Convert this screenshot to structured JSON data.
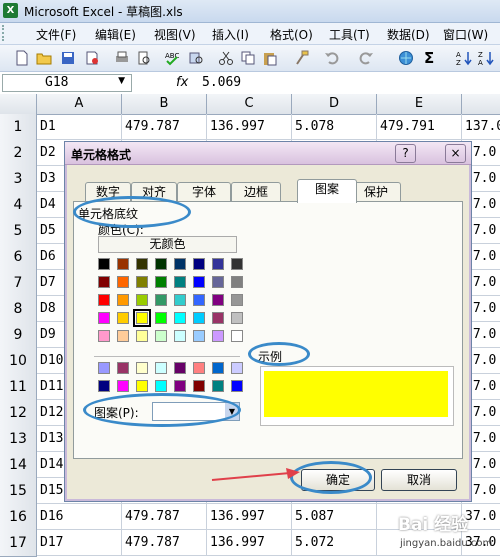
{
  "app": {
    "icon_letter": "X",
    "title": "Microsoft Excel - 草稿图.xls",
    "menus": [
      "文件(F)",
      "编辑(E)",
      "视图(V)",
      "插入(I)",
      "格式(O)",
      "工具(T)",
      "数据(D)",
      "窗口(W)"
    ],
    "name_box": "G18",
    "fx": "fx",
    "formula_value": "5.069"
  },
  "grid": {
    "columns": [
      "A",
      "B",
      "C",
      "D",
      "E",
      ""
    ],
    "rows": [
      {
        "num": "1",
        "cells": [
          "D1",
          "479.787",
          "136.997",
          "5.078",
          "479.791",
          "137.0"
        ]
      },
      {
        "num": "2",
        "cells": [
          "D2",
          "",
          "",
          "",
          "",
          "37.0"
        ]
      },
      {
        "num": "3",
        "cells": [
          "D3",
          "",
          "",
          "",
          "",
          "37.0"
        ]
      },
      {
        "num": "4",
        "cells": [
          "D4",
          "",
          "",
          "",
          "",
          "37.0"
        ]
      },
      {
        "num": "5",
        "cells": [
          "D5",
          "",
          "",
          "",
          "",
          "37.0"
        ]
      },
      {
        "num": "6",
        "cells": [
          "D6",
          "",
          "",
          "",
          "",
          "37.0"
        ]
      },
      {
        "num": "7",
        "cells": [
          "D7",
          "",
          "",
          "",
          "",
          "37.0"
        ]
      },
      {
        "num": "8",
        "cells": [
          "D8",
          "",
          "",
          "",
          "",
          "37.0"
        ]
      },
      {
        "num": "9",
        "cells": [
          "D9",
          "",
          "",
          "",
          "",
          "37.0"
        ]
      },
      {
        "num": "10",
        "cells": [
          "D10",
          "",
          "",
          "",
          "",
          "37.0"
        ]
      },
      {
        "num": "11",
        "cells": [
          "D11",
          "",
          "",
          "",
          "",
          "37.0"
        ]
      },
      {
        "num": "12",
        "cells": [
          "D12",
          "",
          "",
          "",
          "",
          "37.0"
        ]
      },
      {
        "num": "13",
        "cells": [
          "D13",
          "",
          "",
          "",
          "",
          "37.0"
        ]
      },
      {
        "num": "14",
        "cells": [
          "D14",
          "",
          "",
          "",
          "",
          "37.0"
        ]
      },
      {
        "num": "15",
        "cells": [
          "D15",
          "",
          "",
          "",
          "",
          "37.0"
        ]
      },
      {
        "num": "16",
        "cells": [
          "D16",
          "479.787",
          "136.997",
          "5.087",
          "",
          "37.0"
        ]
      },
      {
        "num": "17",
        "cells": [
          "D17",
          "479.787",
          "136.997",
          "5.072",
          "",
          "37.0"
        ]
      }
    ]
  },
  "dialog": {
    "title": "单元格格式",
    "help": "?",
    "close": "×",
    "tabs": [
      "数字",
      "对齐",
      "字体",
      "边框",
      "图案",
      "保护"
    ],
    "active_tab": "图案",
    "section_label": "单元格底纹",
    "color_label": "颜色(C):",
    "no_color": "无颜色",
    "sample_label": "示例",
    "sample_color": "#ffff00",
    "pattern_label": "图案(P):",
    "ok": "确定",
    "cancel": "取消",
    "palette_main": [
      [
        "#000000",
        "#993300",
        "#333300",
        "#003300",
        "#003366",
        "#000080",
        "#333399",
        "#333333"
      ],
      [
        "#800000",
        "#ff6600",
        "#808000",
        "#008000",
        "#008080",
        "#0000ff",
        "#666699",
        "#808080"
      ],
      [
        "#ff0000",
        "#ff9900",
        "#99cc00",
        "#339966",
        "#33cccc",
        "#3366ff",
        "#800080",
        "#969696"
      ],
      [
        "#ff00ff",
        "#ffcc00",
        "#ffff00",
        "#00ff00",
        "#00ffff",
        "#00ccff",
        "#993366",
        "#c0c0c0"
      ],
      [
        "#ff99cc",
        "#ffcc99",
        "#ffff99",
        "#ccffcc",
        "#ccffff",
        "#99ccff",
        "#cc99ff",
        "#ffffff"
      ]
    ],
    "palette_extra": [
      [
        "#9999ff",
        "#993366",
        "#ffffcc",
        "#ccffff",
        "#660066",
        "#ff8080",
        "#0066cc",
        "#ccccff"
      ],
      [
        "#000080",
        "#ff00ff",
        "#ffff00",
        "#00ffff",
        "#800080",
        "#800000",
        "#008080",
        "#0000ff"
      ]
    ]
  },
  "watermark": {
    "text": "Bai 经验",
    "url": "jingyan.baidu.com"
  }
}
